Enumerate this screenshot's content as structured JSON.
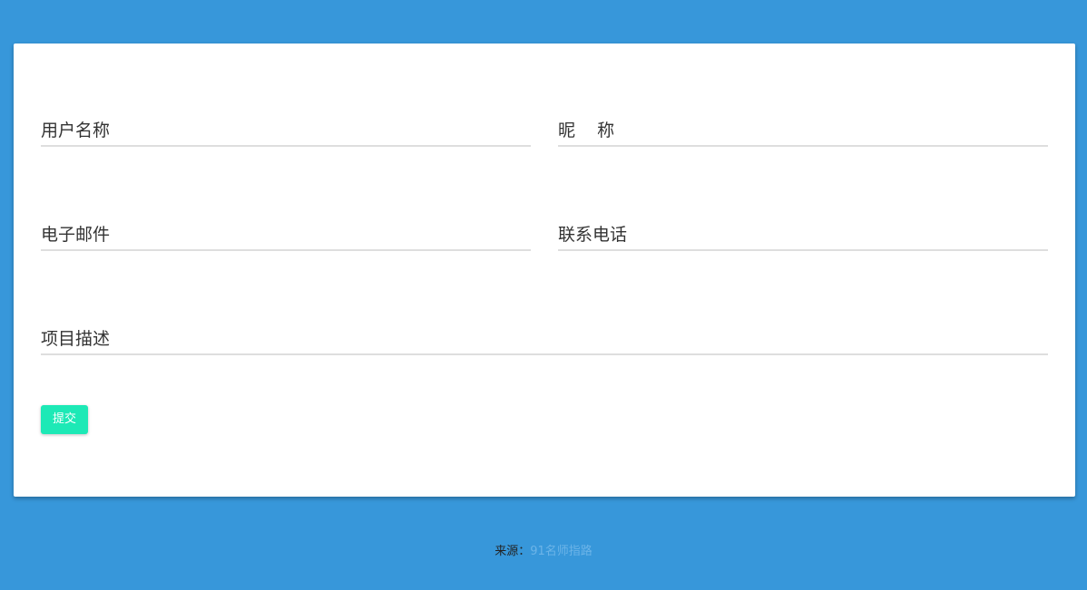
{
  "form": {
    "fields": [
      {
        "label": "用户名称",
        "value": ""
      },
      {
        "label": "昵    称",
        "value": ""
      },
      {
        "label": "电子邮件",
        "value": ""
      },
      {
        "label": "联系电话",
        "value": ""
      },
      {
        "label": "项目描述",
        "value": ""
      }
    ],
    "submit_label": "提交"
  },
  "footer": {
    "source_label": "来源：",
    "source_link": "91名师指路"
  },
  "colors": {
    "background": "#3797da",
    "card": "#ffffff",
    "button": "#1de9b6",
    "underline": "#dedede",
    "link": "#6cb4e8"
  }
}
